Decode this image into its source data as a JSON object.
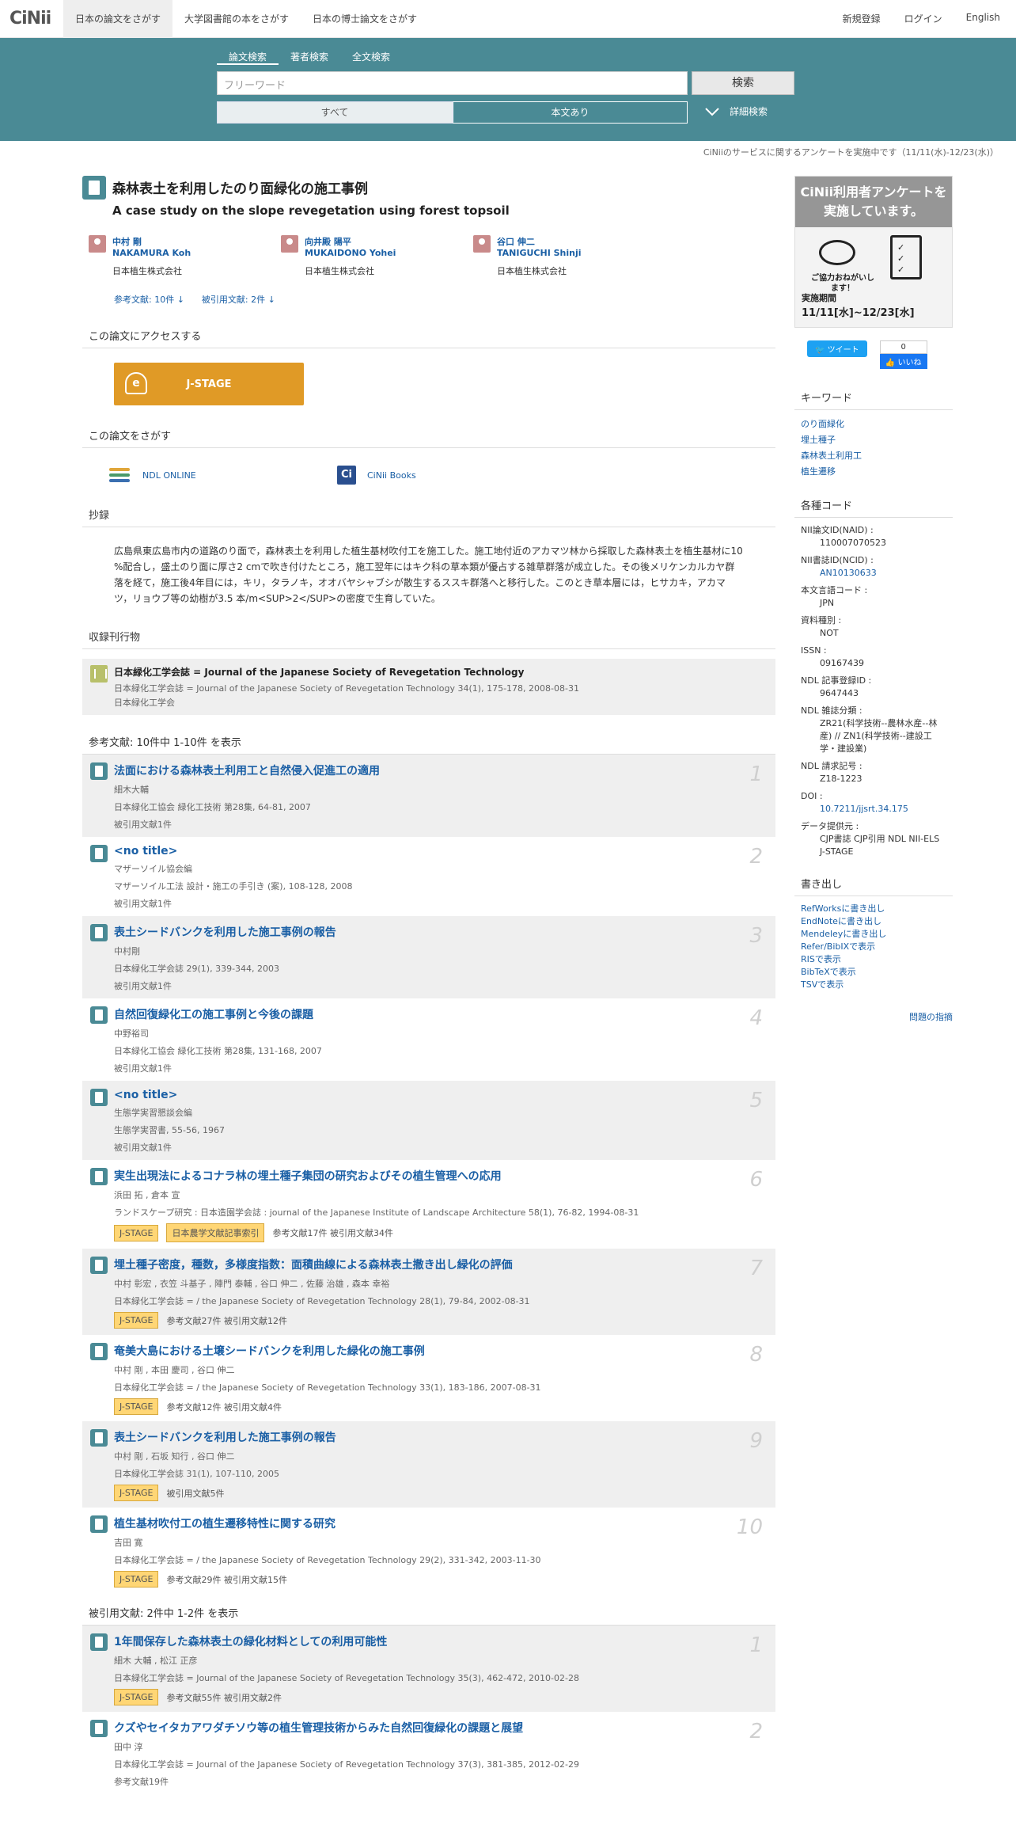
{
  "nav": {
    "logo": "CiNii",
    "tabs": [
      "日本の論文をさがす",
      "大学図書館の本をさがす",
      "日本の博士論文をさがす"
    ],
    "right": [
      "新規登録",
      "ログイン",
      "English"
    ]
  },
  "search": {
    "tabs": [
      "論文検索",
      "著者検索",
      "全文検索"
    ],
    "placeholder": "フリーワード",
    "button": "検索",
    "filter_all": "すべて",
    "filter_fulltext": "本文あり",
    "advanced": "詳細検索"
  },
  "notice": "CiNiiのサービスに関するアンケートを実施中です（11/11(水)-12/23(水)）",
  "article": {
    "title_ja": "森林表土を利用したのり面緑化の施工事例",
    "title_en": "A case study on the slope revegetation using forest topsoil",
    "authors": [
      {
        "name_ja": "中村 剛",
        "name_en": "NAKAMURA Koh",
        "affiliation": "日本植生株式会社"
      },
      {
        "name_ja": "向井殿 陽平",
        "name_en": "MUKAIDONO Yohei",
        "affiliation": "日本植生株式会社"
      },
      {
        "name_ja": "谷口 伸二",
        "name_en": "TANIGUCHI Shinji",
        "affiliation": "日本植生株式会社"
      }
    ],
    "refs_link": "参考文献: 10件",
    "cited_link": "被引用文献: 2件",
    "access_h": "この論文にアクセスする",
    "jstage": "J-STAGE",
    "find_h": "この論文をさがす",
    "ndl": "NDL ONLINE",
    "cinii_books": "CiNii Books",
    "abstract_h": "抄録",
    "abstract": "広島県東広島市内の道路のり面で，森林表土を利用した植生基材吹付工を施工した。施工地付近のアカマツ林から採取した森林表土を植生基材に10 %配合し，盛土のり面に厚さ2 cmで吹き付けたところ，施工翌年にはキク科の草本類が優占する雑草群落が成立した。その後メリケンカルカヤ群落を経て，施工後4年目には，キリ，タラノキ，オオバヤシャブシが散生するススキ群落へと移行した。このとき草本層には，ヒサカキ，アカマツ，リョウブ等の幼樹が3.5 本/m<SUP>2</SUP>の密度で生育していた。",
    "journal_h": "収録刊行物",
    "journal_title": "日本緑化工学会誌 = Journal of the Japanese Society of Revegetation Technology",
    "journal_detail": "日本緑化工学会誌 = Journal of the Japanese Society of Revegetation Technology 34(1), 175-178, 2008-08-31",
    "journal_publisher": "日本緑化工学会"
  },
  "references": {
    "header": "参考文献:  10件中 1-10件 を表示",
    "items": [
      {
        "num": "1",
        "title": "法面における森林表土利用工と自然侵入促進工の適用",
        "author": "細木大輔",
        "source": "日本緑化工協会 緑化工技術 第28集, 64-81, 2007",
        "meta": "被引用文献1件"
      },
      {
        "num": "2",
        "title": "<no title>",
        "author": "マザーソイル協会編",
        "source": "マザーソイル工法 設計・施工の手引き (案), 108-128, 2008",
        "meta": "被引用文献1件"
      },
      {
        "num": "3",
        "title": "表土シードバンクを利用した施工事例の報告",
        "author": "中村剛",
        "source": "日本緑化工学会誌 29(1), 339-344, 2003",
        "meta": "被引用文献1件"
      },
      {
        "num": "4",
        "title": "自然回復緑化工の施工事例と今後の課題",
        "author": "中野裕司",
        "source": "日本緑化工協会 緑化工技術 第28集, 131-168, 2007",
        "meta": "被引用文献1件"
      },
      {
        "num": "5",
        "title": "<no title>",
        "author": "生態学実習懇談会編",
        "source": "生態学実習書, 55-56, 1967",
        "meta": "被引用文献1件"
      },
      {
        "num": "6",
        "title": "実生出現法によるコナラ林の埋土種子集団の研究およびその植生管理への応用",
        "author": "浜田 拓 , 倉本 宣",
        "source": "ランドスケープ研究 : 日本造園学会誌 : journal of the Japanese Institute of Landscape Architecture 58(1), 76-82, 1994-08-31",
        "tags": [
          "J-STAGE",
          "日本農学文献記事索引"
        ],
        "meta": "参考文献17件  被引用文献34件"
      },
      {
        "num": "7",
        "title": "埋土種子密度，種数，多様度指数：面積曲線による森林表土撒き出し緑化の評価",
        "author": "中村 彰宏 , 衣笠 斗基子 , 陣門 泰輔 , 谷口 伸二 , 佐藤 治雄 , 森本 幸裕",
        "source": "日本緑化工学会誌 = / the Japanese Society of Revegetation Technology 28(1), 79-84, 2002-08-31",
        "tags": [
          "J-STAGE"
        ],
        "meta": "参考文献27件  被引用文献12件"
      },
      {
        "num": "8",
        "title": "奄美大島における土壌シードバンクを利用した緑化の施工事例",
        "author": "中村 剛 , 本田 慶司 , 谷口 伸二",
        "source": "日本緑化工学会誌 = / the Japanese Society of Revegetation Technology 33(1), 183-186, 2007-08-31",
        "tags": [
          "J-STAGE"
        ],
        "meta": "参考文献12件  被引用文献4件"
      },
      {
        "num": "9",
        "title": "表土シードバンクを利用した施工事例の報告",
        "author": "中村 剛 , 石坂 知行 , 谷口 伸二",
        "source": "日本緑化工学会誌 31(1), 107-110, 2005",
        "tags": [
          "J-STAGE"
        ],
        "meta": "被引用文献5件"
      },
      {
        "num": "10",
        "title": "植生基材吹付工の植生遷移特性に関する研究",
        "author": "吉田 寛",
        "source": "日本緑化工学会誌 = / the Japanese Society of Revegetation Technology 29(2), 331-342, 2003-11-30",
        "tags": [
          "J-STAGE"
        ],
        "meta": "参考文献29件  被引用文献15件"
      }
    ]
  },
  "cited": {
    "header": "被引用文献:  2件中 1-2件 を表示",
    "items": [
      {
        "num": "1",
        "title": "1年間保存した森林表土の緑化材料としての利用可能性",
        "author": "細木 大輔 , 松江 正彦",
        "source": "日本緑化工学会誌 = Journal of the Japanese Society of Revegetation Technology 35(3), 462-472, 2010-02-28",
        "tags": [
          "J-STAGE"
        ],
        "meta": "参考文献55件  被引用文献2件"
      },
      {
        "num": "2",
        "title": "クズやセイタカアワダチソウ等の植生管理技術からみた自然回復緑化の課題と展望",
        "author": "田中 淳",
        "source": "日本緑化工学会誌 = Journal of the Japanese Society of Revegetation Technology 37(3), 381-385, 2012-02-29",
        "meta": "参考文献19件"
      }
    ]
  },
  "sidebar": {
    "survey_title": "CiNii利用者アンケートを実施しています。",
    "survey_msg": "ご協力おねがいします！",
    "survey_period_label": "実施期間",
    "survey_period": "11/11[水]~12/23[水]",
    "tweet": "ツイート",
    "like_count": "0",
    "like": "いいね",
    "keywords_h": "キーワード",
    "keywords": [
      "のり面緑化",
      "埋土種子",
      "森林表土利用工",
      "植生遷移"
    ],
    "codes_h": "各種コード",
    "codes": [
      {
        "label": "NII論文ID(NAID) :",
        "value": "110007070523"
      },
      {
        "label": "NII書誌ID(NCID) :",
        "value": "AN10130633",
        "link": true
      },
      {
        "label": "本文言語コード :",
        "value": "JPN"
      },
      {
        "label": "資料種別 :",
        "value": "NOT"
      },
      {
        "label": "ISSN :",
        "value": "09167439"
      },
      {
        "label": "NDL 記事登録ID :",
        "value": "9647443"
      },
      {
        "label": "NDL 雑誌分類 :",
        "value": "ZR21(科学技術--農林水産--林産) // ZN1(科学技術--建設工学・建設業)"
      },
      {
        "label": "NDL 請求記号 :",
        "value": "Z18-1223"
      },
      {
        "label": "DOI :",
        "value": "10.7211/jjsrt.34.175",
        "link": true
      },
      {
        "label": "データ提供元 :",
        "value": "CJP書誌  CJP引用  NDL  NII-ELS  J-STAGE"
      }
    ],
    "export_h": "書き出し",
    "export": [
      "RefWorksに書き出し",
      "EndNoteに書き出し",
      "Mendeleyに書き出し",
      "Refer/BibIXで表示",
      "RISで表示",
      "BibTeXで表示",
      "TSVで表示"
    ],
    "report": "問題の指摘"
  },
  "colors": {
    "banner": "#4a8a95",
    "link": "#1a5fa5",
    "jstage": "#e09a26",
    "tag": "#ffd675"
  }
}
